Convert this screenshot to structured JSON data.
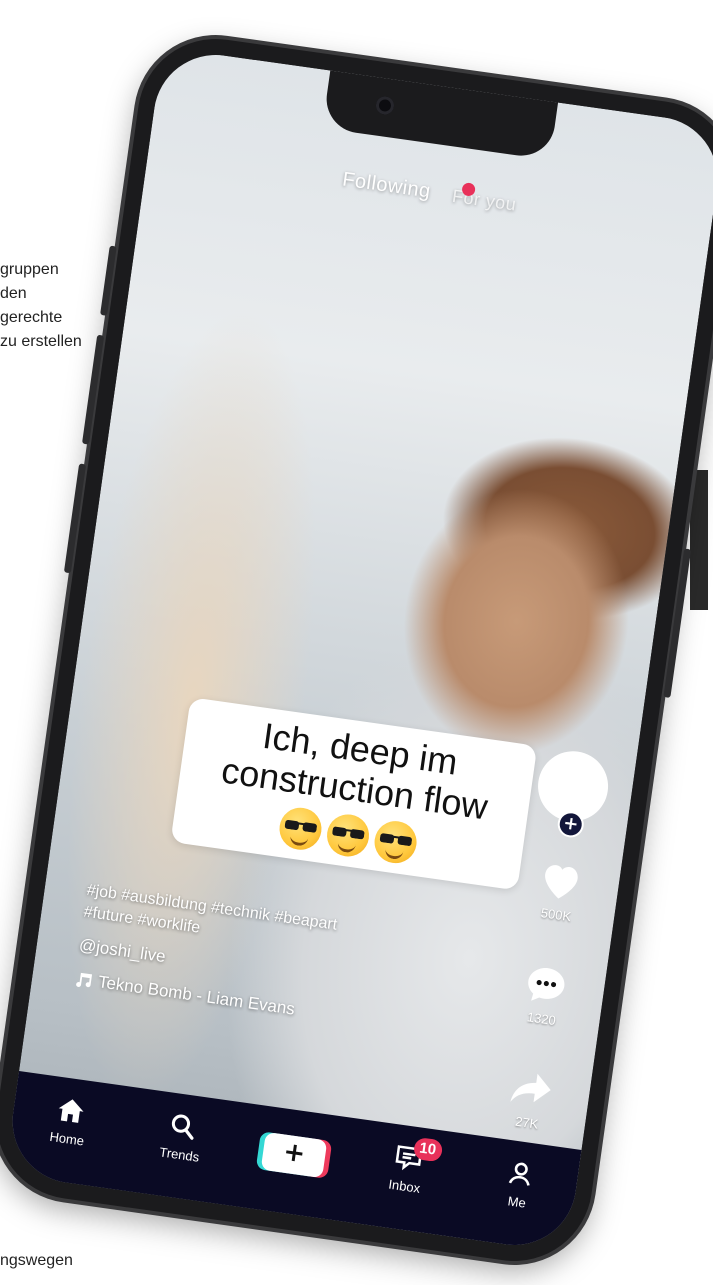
{
  "background": {
    "side_text": [
      "gruppen",
      "den",
      "gerechte",
      "zu erstellen"
    ],
    "bottom_text": "ngswegen"
  },
  "top_tabs": {
    "following": "Following",
    "for_you": "For you"
  },
  "caption": {
    "line1": "Ich, deep im",
    "line2": "construction flow",
    "emoji_name": "smiling-face-with-sunglasses"
  },
  "actions": {
    "likes": "500K",
    "comments": "1320",
    "shares": "27K"
  },
  "post": {
    "hashtags": "#job #ausbildung #technik #beapart #future #worklife",
    "username": "@joshi_live",
    "music": "Tekno Bomb - Liam Evans"
  },
  "nav": {
    "home": "Home",
    "trends": "Trends",
    "create": "+",
    "inbox": "Inbox",
    "inbox_badge": "10",
    "me": "Me"
  },
  "colors": {
    "accent_red": "#e8315a",
    "accent_cyan": "#34d8d4",
    "nav_bg": "#0a0a24",
    "phone_frame": "#1b1b1d"
  }
}
